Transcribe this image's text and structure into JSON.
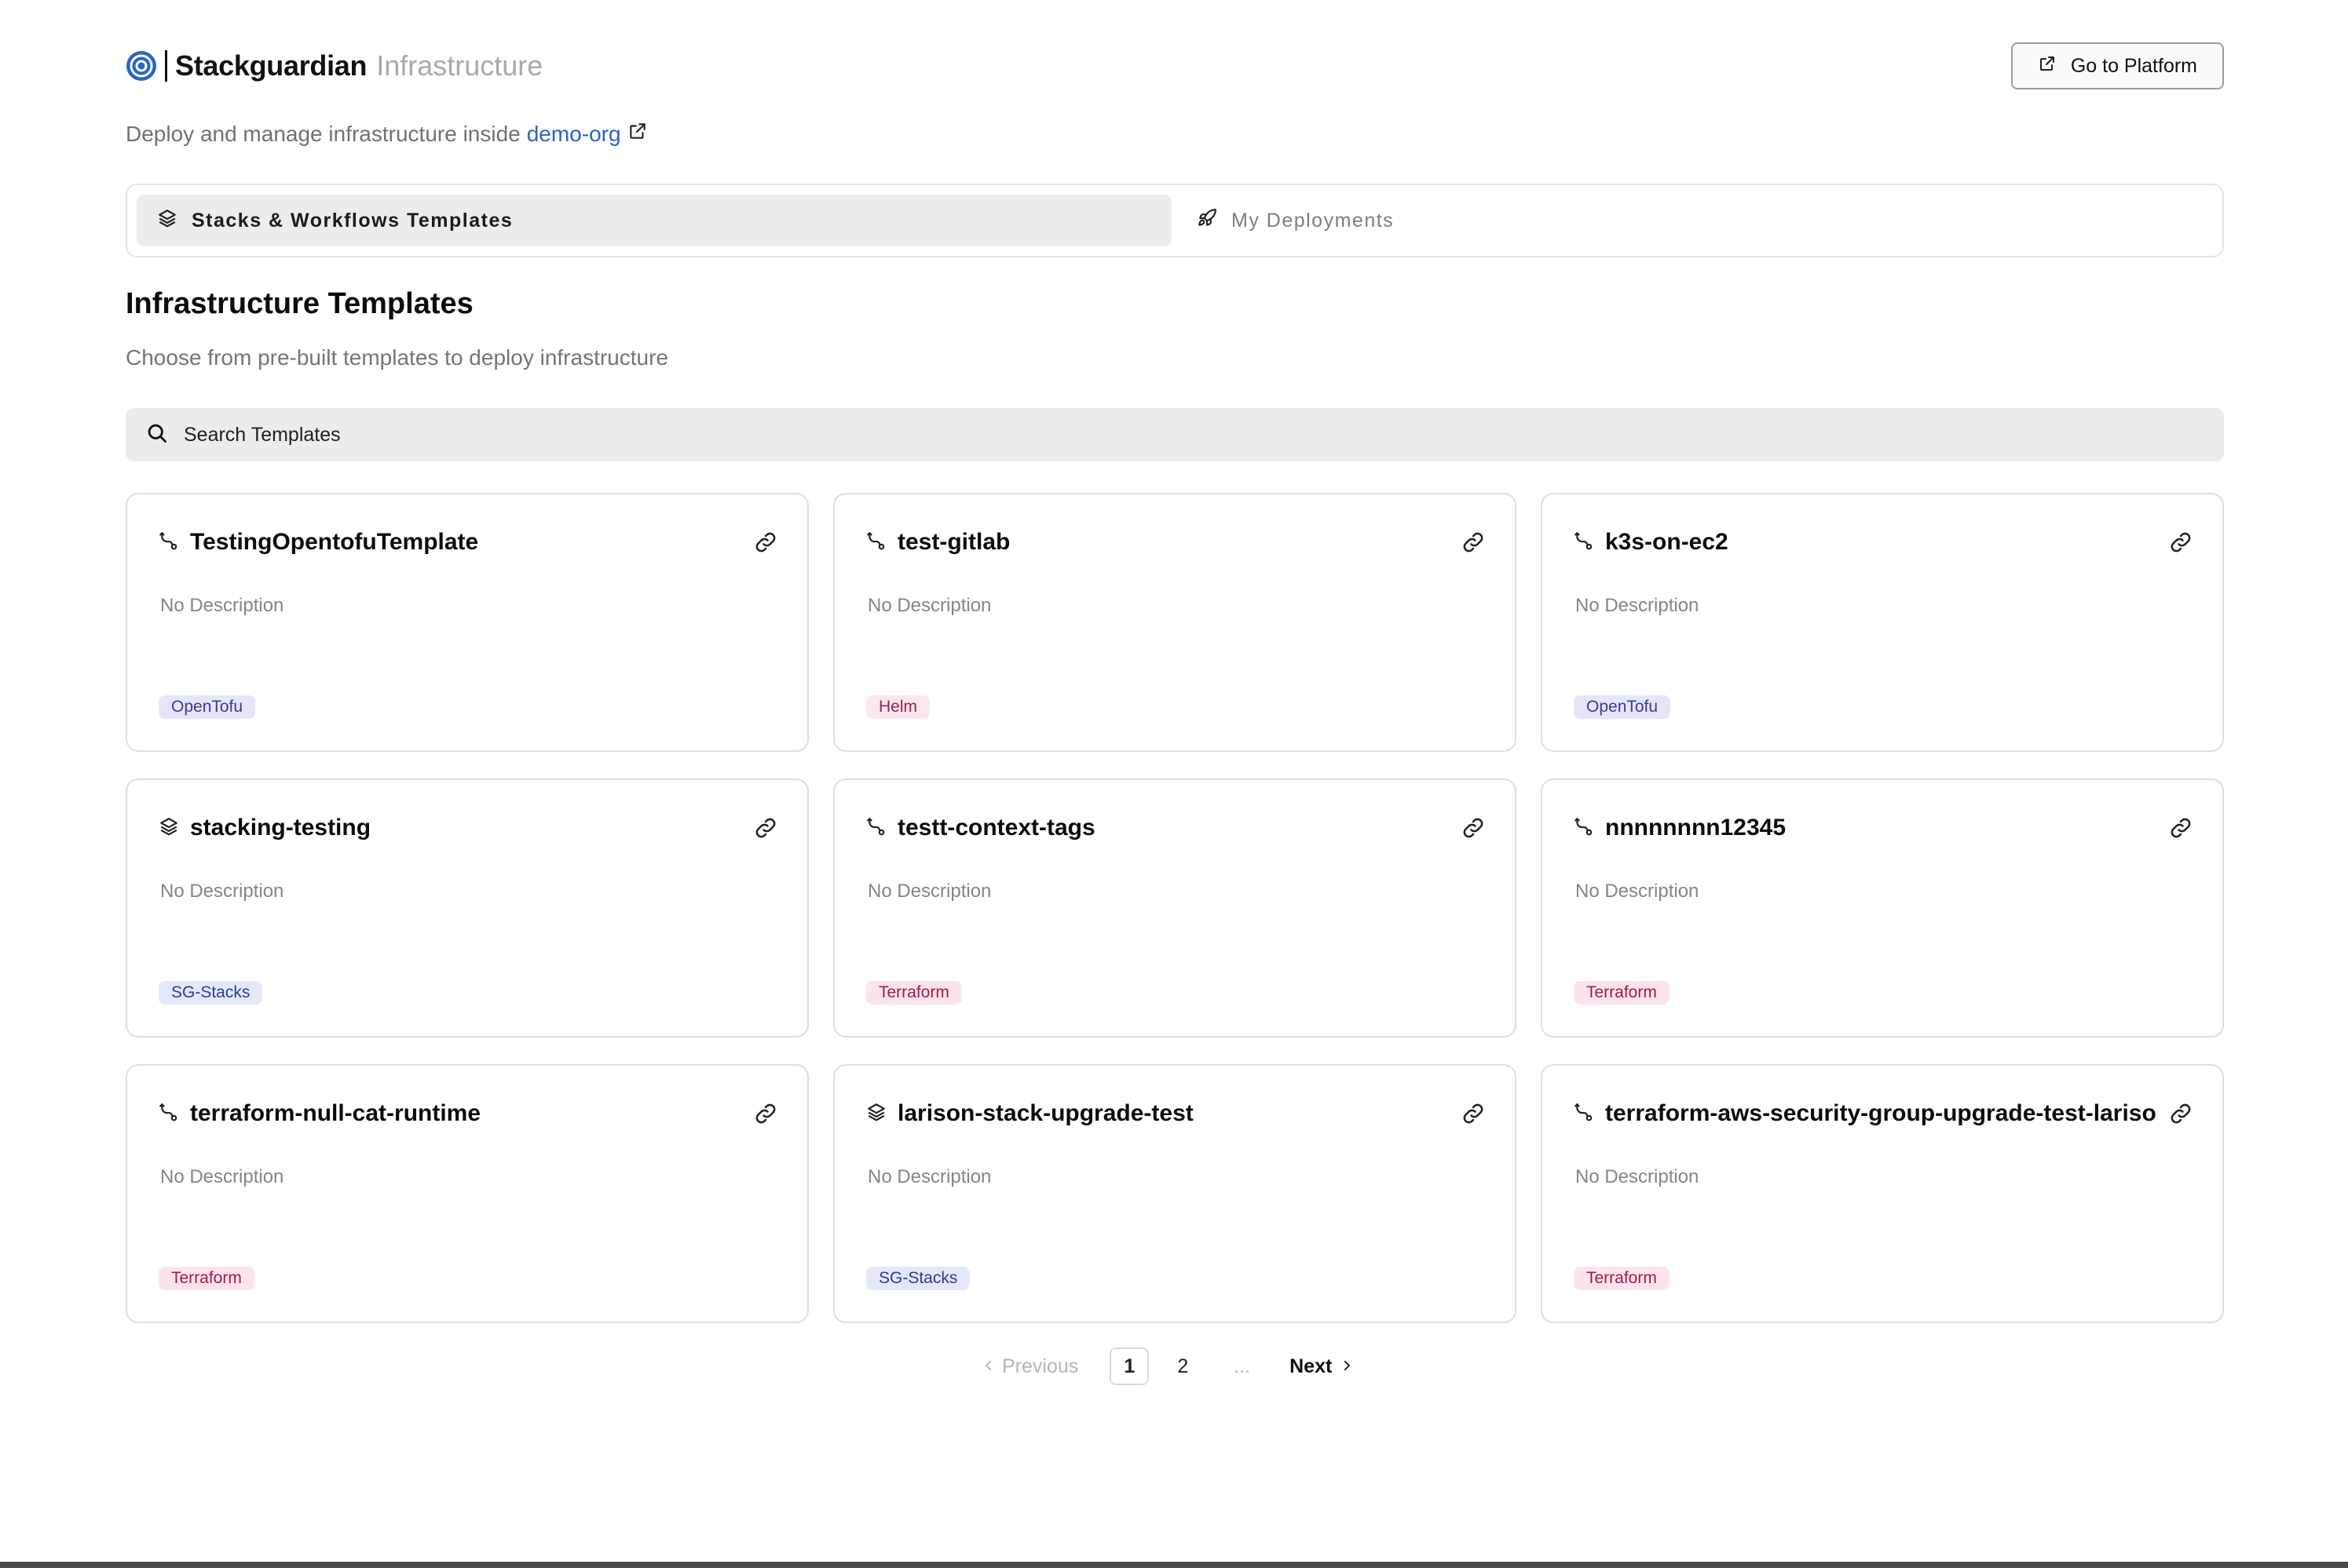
{
  "header": {
    "brand_name": "Stackguardian",
    "brand_sub": "Infrastructure",
    "go_platform_label": "Go to Platform"
  },
  "org_line": {
    "prefix": "Deploy and manage infrastructure inside",
    "org_name": "demo-org"
  },
  "tabs": [
    {
      "label": "Stacks & Workflows Templates",
      "active": true
    },
    {
      "label": "My Deployments",
      "active": false
    }
  ],
  "section": {
    "title": "Infrastructure Templates",
    "description": "Choose from pre-built templates to deploy infrastructure"
  },
  "search": {
    "placeholder": "Search Templates",
    "value": ""
  },
  "templates": [
    {
      "name": "TestingOpentofuTemplate",
      "description": "No Description",
      "tag": "OpenTofu",
      "kind": "workflow"
    },
    {
      "name": "test-gitlab",
      "description": "No Description",
      "tag": "Helm",
      "kind": "workflow"
    },
    {
      "name": "k3s-on-ec2",
      "description": "No Description",
      "tag": "OpenTofu",
      "kind": "workflow"
    },
    {
      "name": "stacking-testing",
      "description": "No Description",
      "tag": "SG-Stacks",
      "kind": "stack"
    },
    {
      "name": "testt-context-tags",
      "description": "No Description",
      "tag": "Terraform",
      "kind": "workflow"
    },
    {
      "name": "nnnnnnnn12345",
      "description": "No Description",
      "tag": "Terraform",
      "kind": "workflow"
    },
    {
      "name": "terraform-null-cat-runtime",
      "description": "No Description",
      "tag": "Terraform",
      "kind": "workflow"
    },
    {
      "name": "larison-stack-upgrade-test",
      "description": "No Description",
      "tag": "SG-Stacks",
      "kind": "stack"
    },
    {
      "name": "terraform-aws-security-group-upgrade-test-larison",
      "description": "No Description",
      "tag": "Terraform",
      "kind": "workflow"
    }
  ],
  "pagination": {
    "previous_label": "Previous",
    "pages": [
      "1",
      "2"
    ],
    "current": "1",
    "ellipsis": "...",
    "next_label": "Next"
  },
  "colors": {
    "accent": "#2a64c8",
    "tab_active_bg": "#ebebf0",
    "tag_opentofu_bg": "#e6e6fa",
    "tag_terraform_bg": "#fde4ec"
  }
}
